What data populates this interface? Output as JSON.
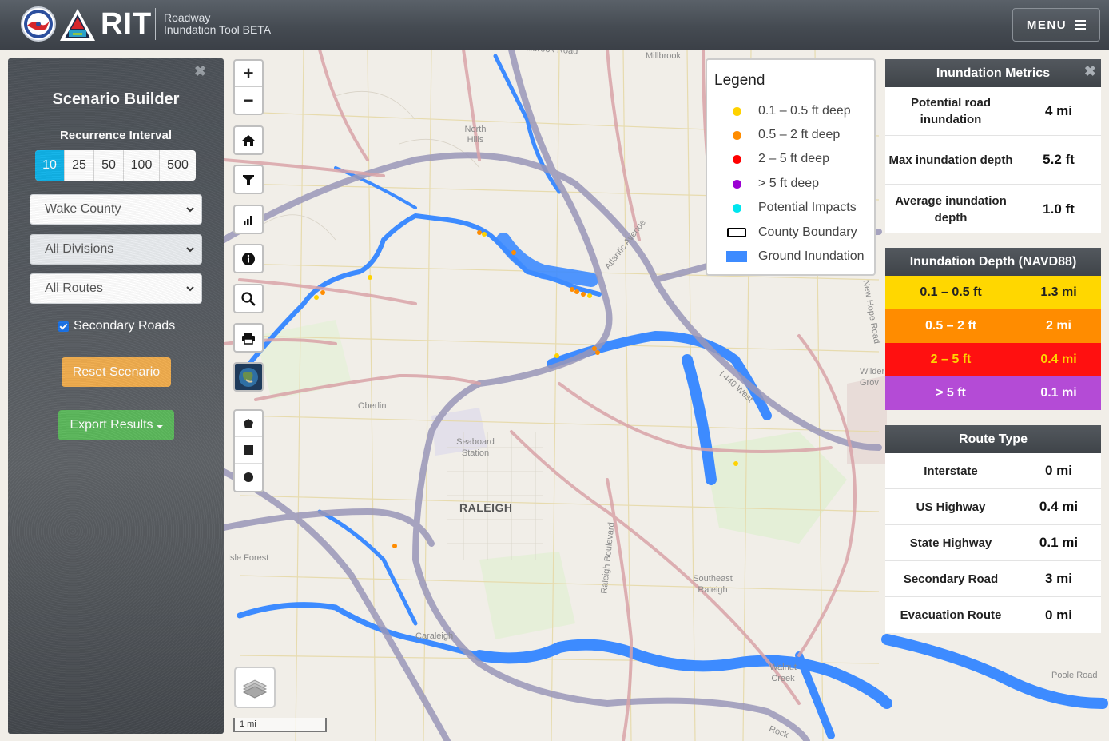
{
  "header": {
    "brand": "RIT",
    "subtitle_line1": "Roadway",
    "subtitle_line2": "Inundation Tool BETA",
    "menu_label": "MENU",
    "menu_icon": "hamburger-icon"
  },
  "scenario_builder": {
    "title": "Scenario Builder",
    "recurrence_label": "Recurrence Interval",
    "recurrence_options": [
      "10",
      "25",
      "50",
      "100",
      "500"
    ],
    "recurrence_selected": "10",
    "county_select": "Wake County",
    "division_select": "All Divisions",
    "route_select": "All Routes",
    "secondary_roads_label": "Secondary Roads",
    "secondary_roads_checked": true,
    "reset_label": "Reset Scenario",
    "export_label": "Export Results"
  },
  "map_tools": {
    "zoom_in": "+",
    "zoom_out": "−",
    "scale_label": "1 mi"
  },
  "map_labels": {
    "raleigh": "RALEIGH",
    "north_hills": "North Hills",
    "oberlin": "Oberlin",
    "seaboard_station": "Seaboard Station",
    "isle_forest": "Isle Forest",
    "caraleigh": "Caraleigh",
    "southeast_raleigh": "Southeast Raleigh",
    "walnut_creek": "Walnut Creek",
    "wilder_grove": "Wilder Grov",
    "poole_road": "Poole Road",
    "atlantic_avenue": "Atlantic Avenue",
    "i440_west": "I 440 West",
    "new_hope_road": "New Hope Road",
    "raleigh_boulevard": "Raleigh Boulevard",
    "millbrook": "Millbrook",
    "millbrook_road": "Millbrook Road",
    "rock": "Rock"
  },
  "legend": {
    "title": "Legend",
    "items": [
      {
        "label": "0.1 – 0.5 ft deep",
        "color": "#ffd200",
        "shape": "dot"
      },
      {
        "label": "0.5 – 2 ft deep",
        "color": "#ff8c00",
        "shape": "dot"
      },
      {
        "label": "2 – 5 ft deep",
        "color": "#ff0000",
        "shape": "dot"
      },
      {
        "label": "> 5 ft deep",
        "color": "#9b00d3",
        "shape": "dot"
      },
      {
        "label": "Potential Impacts",
        "color": "#00e5ee",
        "shape": "dot"
      },
      {
        "label": "County Boundary",
        "color": "#000000",
        "shape": "outline"
      },
      {
        "label": "Ground Inundation",
        "color": "#3d8bff",
        "shape": "fill"
      }
    ]
  },
  "inundation_metrics": {
    "title": "Inundation Metrics",
    "rows": [
      {
        "label": "Potential road inundation",
        "value": "4 mi"
      },
      {
        "label": "Max inundation depth",
        "value": "5.2 ft"
      },
      {
        "label": "Average inundation depth",
        "value": "1.0 ft"
      }
    ]
  },
  "inundation_depth": {
    "title": "Inundation Depth (NAVD88)",
    "rows": [
      {
        "label": "0.1 – 0.5 ft",
        "value": "1.3 mi",
        "color": "#ffd700",
        "text": "#222222"
      },
      {
        "label": "0.5 – 2 ft",
        "value": "2 mi",
        "color": "#ff8c00",
        "text": "#ffffff"
      },
      {
        "label": "2 – 5 ft",
        "value": "0.4 mi",
        "color": "#ff1010",
        "text": "#ffd400"
      },
      {
        "label": "> 5 ft",
        "value": "0.1 mi",
        "color": "#b44bd6",
        "text": "#ffffff"
      }
    ]
  },
  "route_type": {
    "title": "Route Type",
    "rows": [
      {
        "label": "Interstate",
        "value": "0 mi"
      },
      {
        "label": "US Highway",
        "value": "0.4 mi"
      },
      {
        "label": "State Highway",
        "value": "0.1 mi"
      },
      {
        "label": "Secondary Road",
        "value": "3 mi"
      },
      {
        "label": "Evacuation Route",
        "value": "0 mi"
      }
    ]
  }
}
